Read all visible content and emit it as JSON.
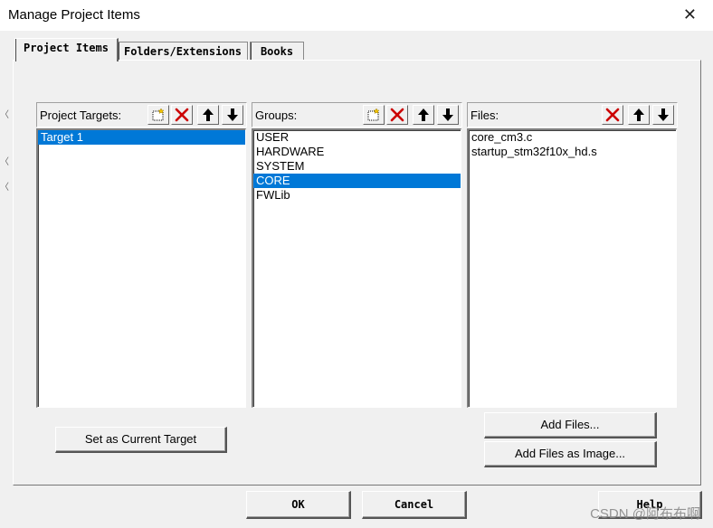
{
  "window": {
    "title": "Manage Project Items",
    "close_glyph": "✕"
  },
  "tabs": [
    {
      "label": "Project Items"
    },
    {
      "label": "Folders/Extensions"
    },
    {
      "label": "Books"
    }
  ],
  "targets": {
    "label": "Project Targets:",
    "items": [
      "Target 1"
    ],
    "selected": 0
  },
  "groups": {
    "label": "Groups:",
    "items": [
      "USER",
      "HARDWARE",
      "SYSTEM",
      "CORE",
      "FWLib"
    ],
    "selected": 3
  },
  "files": {
    "label": "Files:",
    "items": [
      "core_cm3.c",
      "startup_stm32f10x_hd.s"
    ]
  },
  "buttons": {
    "set_current": "Set as Current Target",
    "add_files": "Add Files...",
    "add_files_image": "Add Files as Image...",
    "ok": "OK",
    "cancel": "Cancel",
    "help": "Help"
  },
  "watermark": "CSDN @阿布布啊",
  "colors": {
    "selection": "#0078d7",
    "delete_icon": "#cc0000"
  }
}
